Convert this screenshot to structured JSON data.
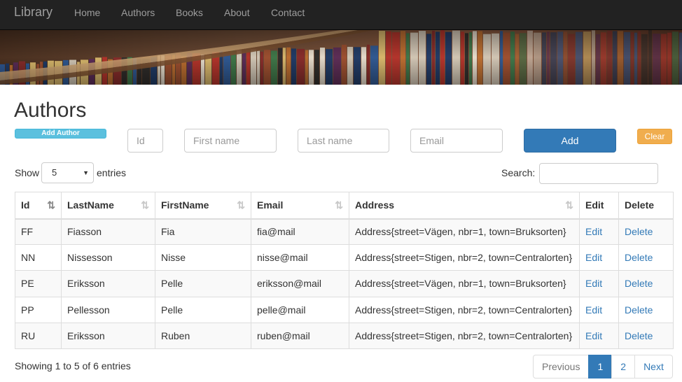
{
  "nav": {
    "brand": "Library",
    "links": [
      "Home",
      "Authors",
      "Books",
      "About",
      "Contact"
    ]
  },
  "page": {
    "title": "Authors",
    "add_author_label": "Add Author"
  },
  "form": {
    "id_placeholder": "Id",
    "firstname_placeholder": "First name",
    "lastname_placeholder": "Last name",
    "email_placeholder": "Email",
    "add_label": "Add",
    "clear_label": "Clear"
  },
  "length": {
    "show_label": "Show",
    "value": "5",
    "entries_label": "entries"
  },
  "search": {
    "label": "Search:",
    "value": ""
  },
  "table": {
    "columns": [
      "Id",
      "LastName",
      "FirstName",
      "Email",
      "Address",
      "Edit",
      "Delete"
    ],
    "rows": [
      {
        "id": "FF",
        "last": "Fiasson",
        "first": "Fia",
        "email": "fia@mail",
        "address": "Address{street=Vägen, nbr=1, town=Bruksorten}",
        "edit": "Edit",
        "delete": "Delete"
      },
      {
        "id": "NN",
        "last": "Nissesson",
        "first": "Nisse",
        "email": "nisse@mail",
        "address": "Address{street=Stigen, nbr=2, town=Centralorten}",
        "edit": "Edit",
        "delete": "Delete"
      },
      {
        "id": "PE",
        "last": "Eriksson",
        "first": "Pelle",
        "email": "eriksson@mail",
        "address": "Address{street=Vägen, nbr=1, town=Bruksorten}",
        "edit": "Edit",
        "delete": "Delete"
      },
      {
        "id": "PP",
        "last": "Pellesson",
        "first": "Pelle",
        "email": "pelle@mail",
        "address": "Address{street=Stigen, nbr=2, town=Centralorten}",
        "edit": "Edit",
        "delete": "Delete"
      },
      {
        "id": "RU",
        "last": "Eriksson",
        "first": "Ruben",
        "email": "ruben@mail",
        "address": "Address{street=Stigen, nbr=2, town=Centralorten}",
        "edit": "Edit",
        "delete": "Delete"
      }
    ]
  },
  "footer": {
    "info": "Showing 1 to 5 of 6 entries",
    "pager": {
      "previous": "Previous",
      "pages": [
        "1",
        "2"
      ],
      "next": "Next"
    }
  },
  "colors": {
    "navbar": "#222222",
    "primary": "#337ab7",
    "info": "#5bc0de",
    "warning": "#f0ad4e"
  }
}
